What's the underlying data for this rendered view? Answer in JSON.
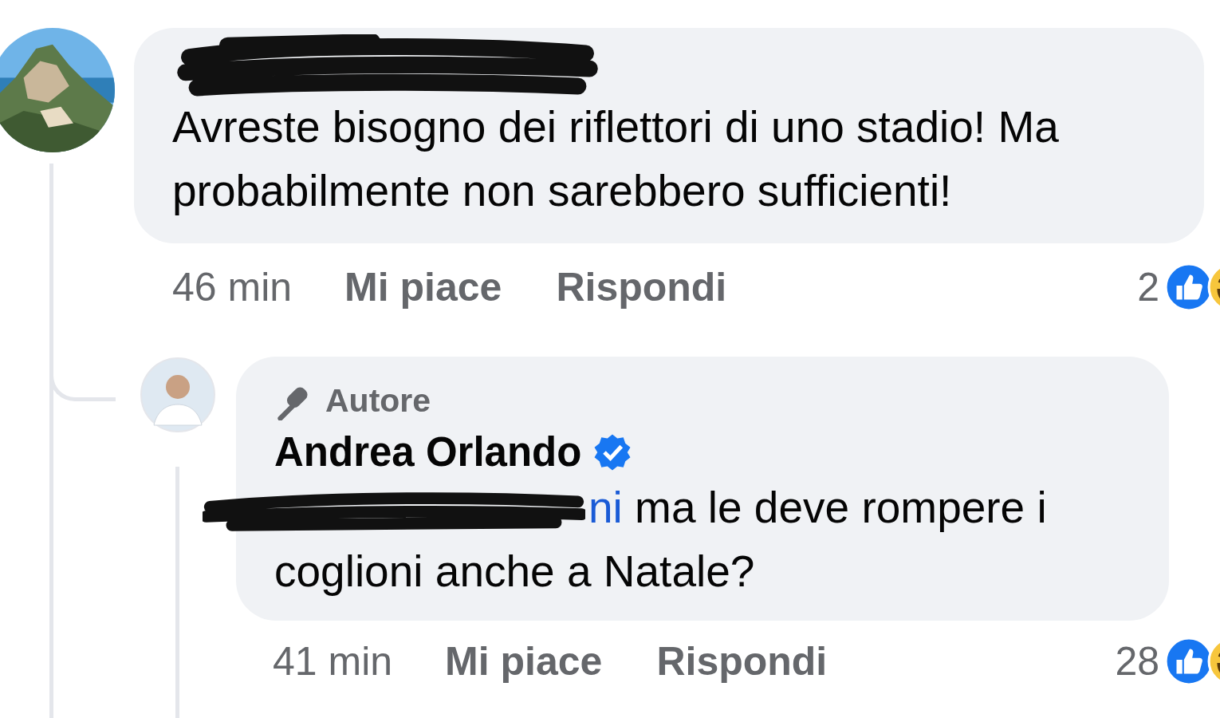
{
  "comment": {
    "name_redacted": true,
    "text": "Avreste bisogno dei riflettori di uno stadio! Ma probabilmente non sarebbero sufficienti!",
    "time": "46 min",
    "actions": [
      "Mi piace",
      "Rispondi"
    ],
    "reaction_count": "2",
    "reply": {
      "badge": "Autore",
      "author": "Andrea Orlando",
      "verified": true,
      "mention_redacted": true,
      "mention": "ni",
      "text": "ma le deve rompere i coglioni anche a Natale?",
      "time": "41 min",
      "actions": [
        "Mi piace",
        "Rispondi"
      ],
      "reaction_count": "28"
    }
  }
}
